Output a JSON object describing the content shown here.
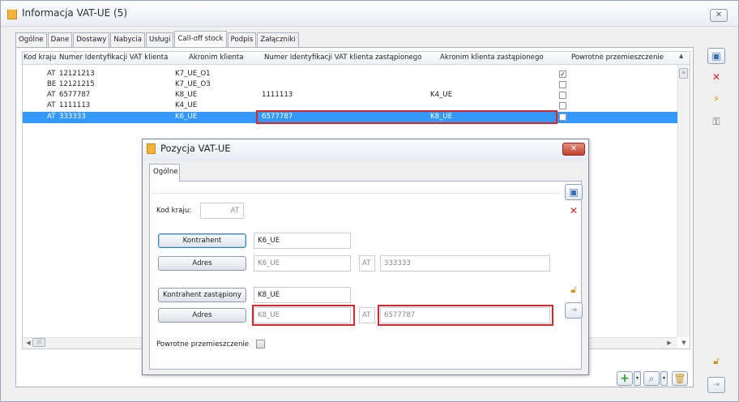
{
  "window": {
    "title": "Informacja VAT-UE (5)",
    "close": "✕"
  },
  "tabs": [
    "Ogólne",
    "Dane",
    "Dostawy",
    "Nabycia",
    "Usługi",
    "Call-off stock",
    "Podpis",
    "Załączniki"
  ],
  "active_tab": "Call-off stock",
  "grid": {
    "columns": [
      "Kod kraju",
      "Numer Identyfikacji VAT klienta",
      "Akronim klienta",
      "Numer Identyfikacji VAT klienta zastąpionego",
      "Akronim klienta zastąpionego",
      "Powrotne przemieszczenie"
    ],
    "rows": [
      {
        "kod": "AT",
        "nip": "12121213",
        "akronim": "K7_UE_O1",
        "nip_z": "",
        "akronim_z": "",
        "powrotne": true
      },
      {
        "kod": "BE",
        "nip": "12121215",
        "akronim": "K7_UE_O3",
        "nip_z": "",
        "akronim_z": "",
        "powrotne": false
      },
      {
        "kod": "AT",
        "nip": "6577787",
        "akronim": "K8_UE",
        "nip_z": "1111113",
        "akronim_z": "K4_UE",
        "powrotne": false
      },
      {
        "kod": "AT",
        "nip": "1111113",
        "akronim": "K4_UE",
        "nip_z": "",
        "akronim_z": "",
        "powrotne": false
      },
      {
        "kod": "AT",
        "nip": "333333",
        "akronim": "K6_UE",
        "nip_z": "6577787",
        "akronim_z": "K8_UE",
        "powrotne": false
      }
    ],
    "selected_row": 4
  },
  "dialog": {
    "title": "Pozycja VAT-UE",
    "tab": "Ogólne",
    "kod_kraju_label": "Kod kraju:",
    "kod_kraju": "AT",
    "kontrahent_btn": "Kontrahent",
    "kontrahent": "K6_UE",
    "adres_btn": "Adres",
    "adres_akronim": "K6_UE",
    "adres_kraj": "AT",
    "adres_nip": "333333",
    "kontrahent_z_btn": "Kontrahent zastąpiony",
    "kontrahent_z": "K8_UE",
    "adres_z_btn": "Adres",
    "adres_z_akronim": "K8_UE",
    "adres_z_kraj": "AT",
    "adres_z_nip": "6577787",
    "powrotne_label": "Powrotne przemieszczenie",
    "powrotne": false,
    "close": "✕"
  },
  "colors": {
    "selection": "#3399ff",
    "highlight": "#d8262c"
  }
}
